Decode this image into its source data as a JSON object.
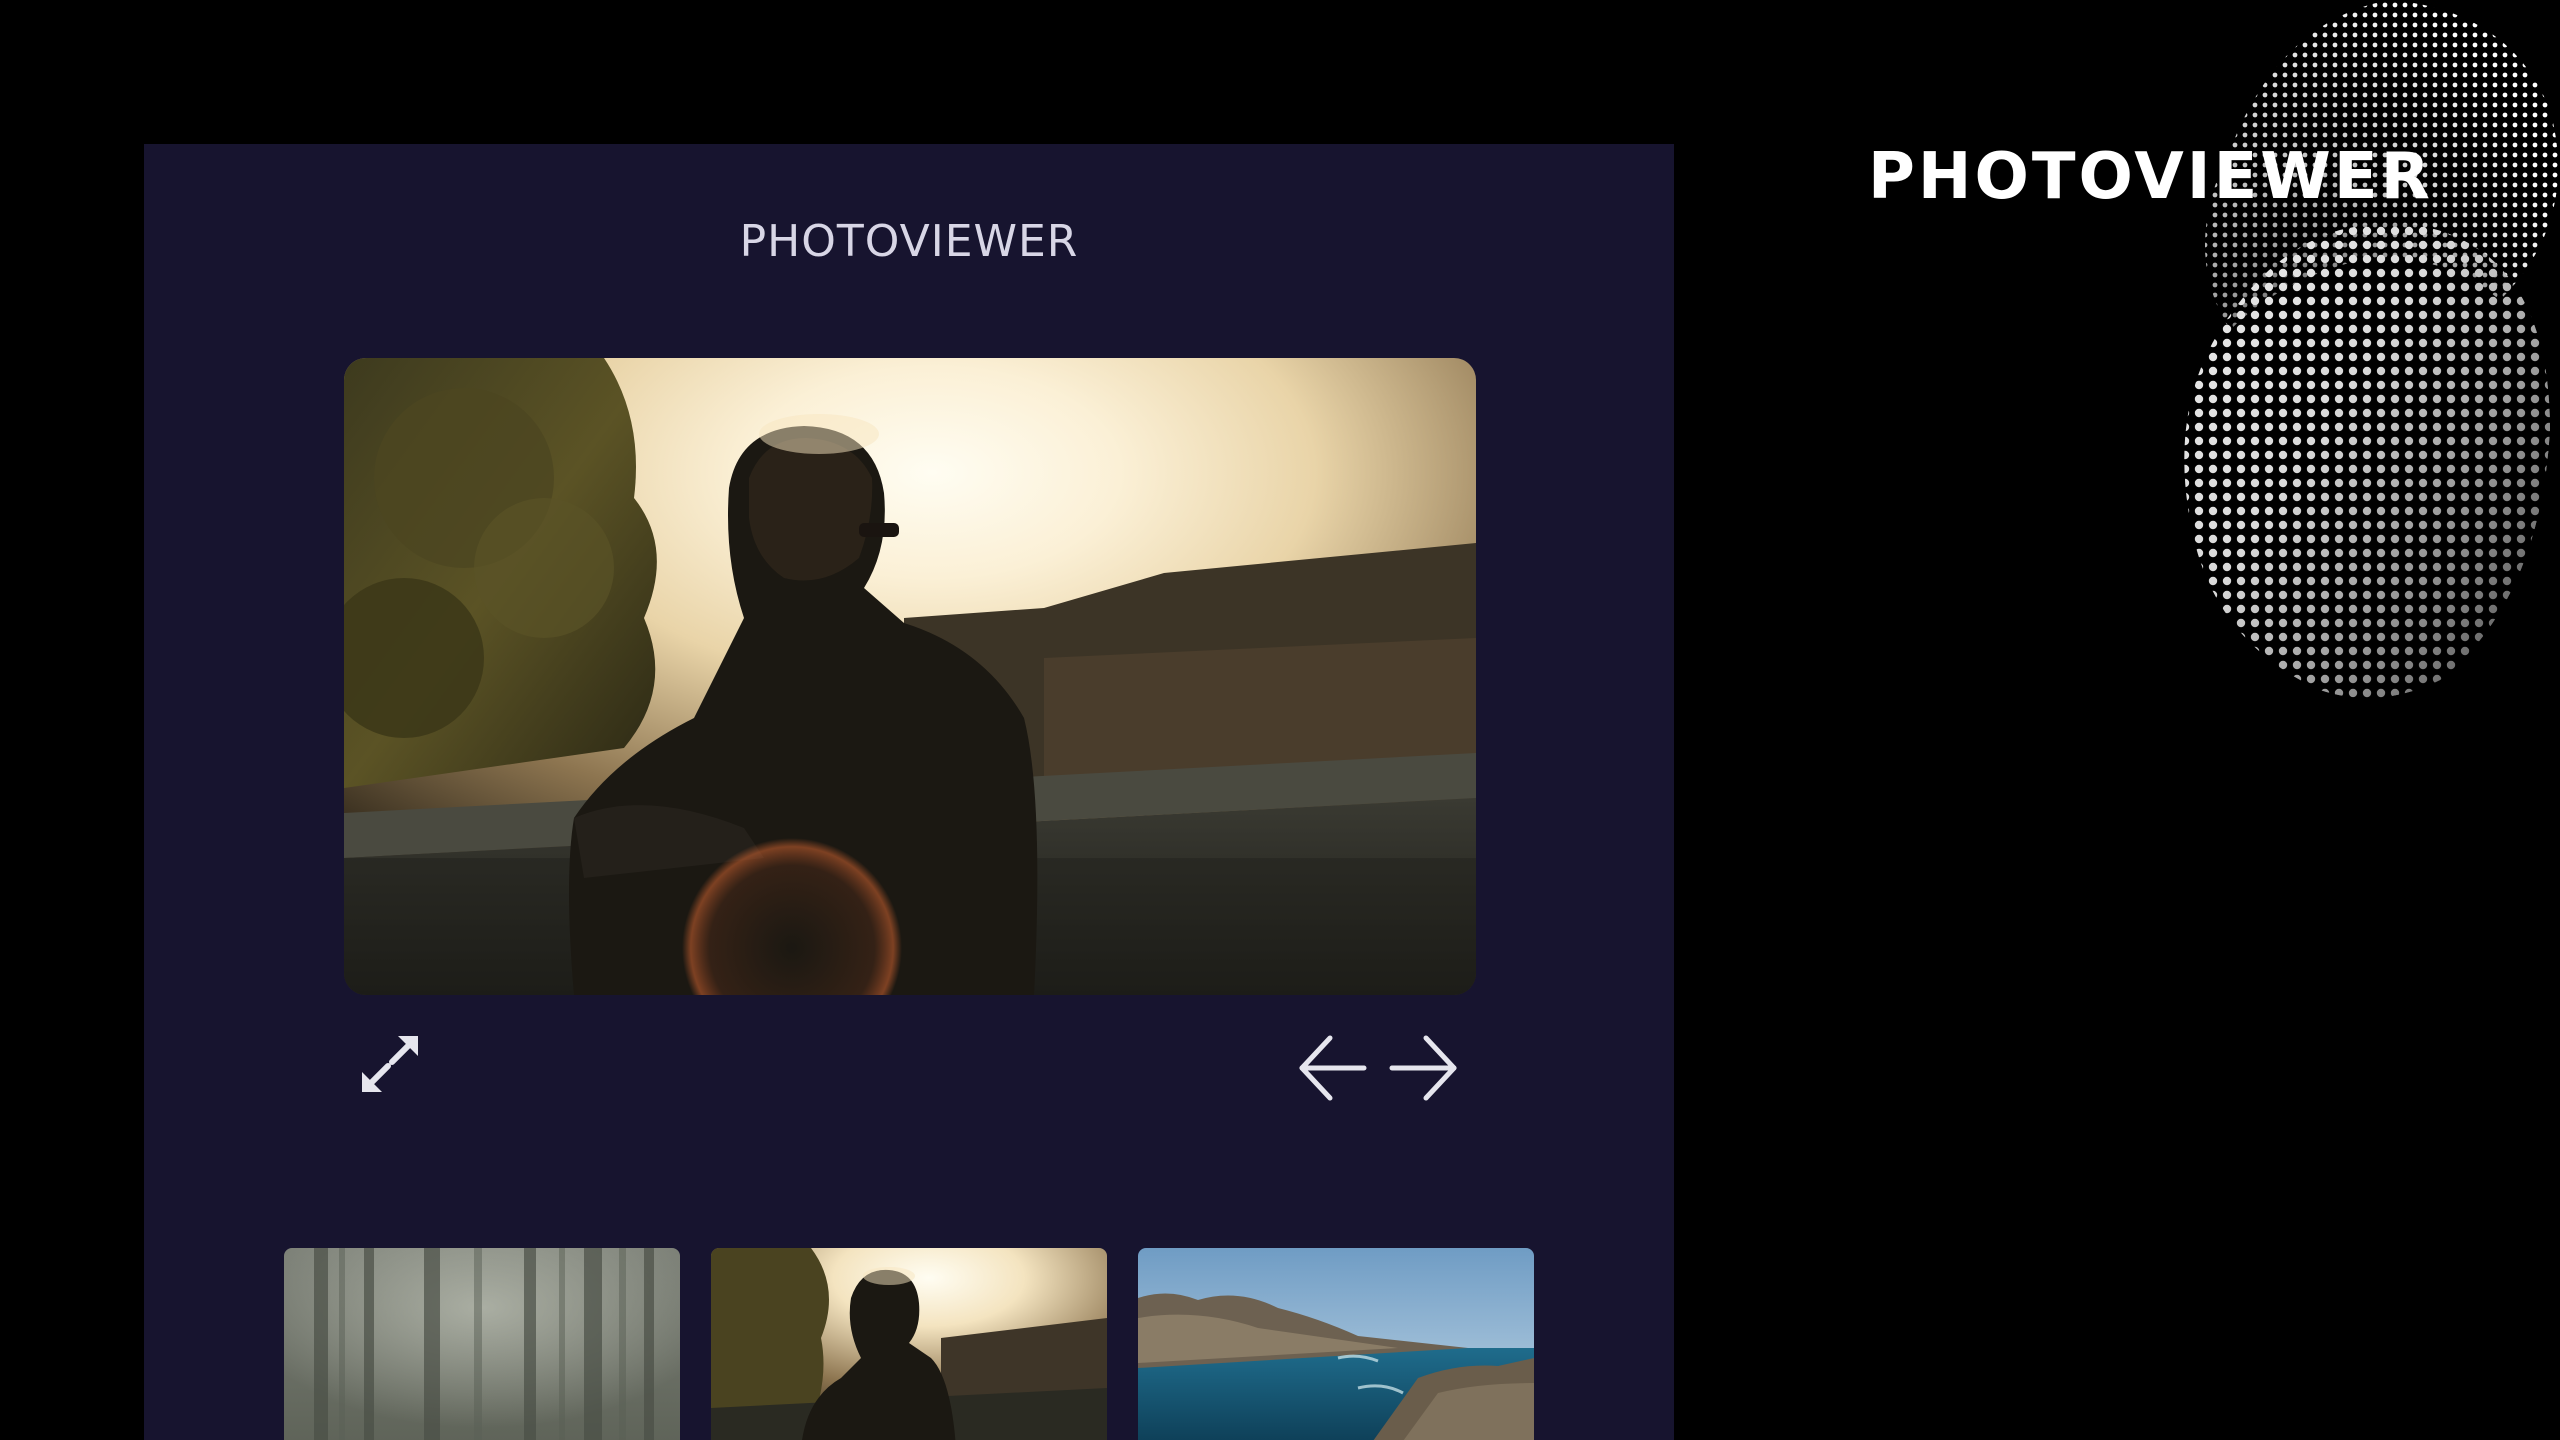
{
  "brand": {
    "title": "PHOTOVIEWER"
  },
  "viewer": {
    "title": "PHOTOVIEWER",
    "main_photo": {
      "subject": "man-on-balcony-at-sunset"
    },
    "controls": {
      "expand_icon": "expand-arrows-icon",
      "prev_icon": "arrow-left-icon",
      "next_icon": "arrow-right-icon"
    },
    "thumbnails": [
      {
        "subject": "misty-forest"
      },
      {
        "subject": "man-on-balcony-at-sunset"
      },
      {
        "subject": "rocky-coast-with-sea"
      }
    ]
  },
  "colors": {
    "page_background": "#000000",
    "panel_background": "#17142f",
    "title_text": "#d8d6e6",
    "icon": "#e6e6ee",
    "brand_text": "#ffffff"
  }
}
